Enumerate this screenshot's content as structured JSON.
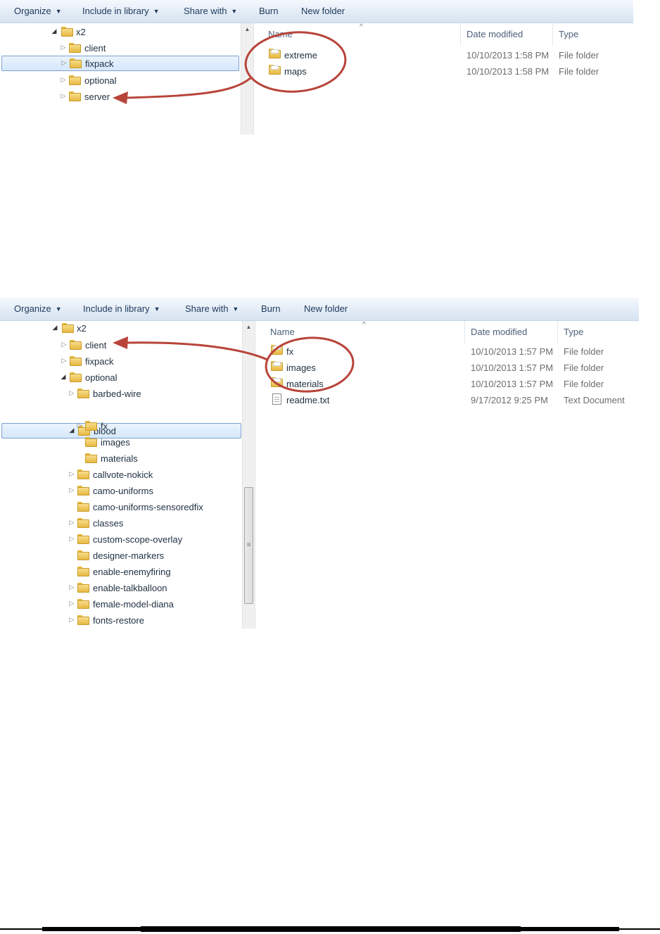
{
  "toolbar": {
    "organize": "Organize",
    "include_in_library": "Include in library",
    "share_with": "Share with",
    "burn": "Burn",
    "new_folder": "New folder"
  },
  "columns": {
    "name": "Name",
    "date_modified": "Date modified",
    "type": "Type"
  },
  "screen1": {
    "tree": [
      {
        "label": "x2"
      },
      {
        "label": "client"
      },
      {
        "label": "fixpack",
        "selected": true
      },
      {
        "label": "optional"
      },
      {
        "label": "server"
      }
    ],
    "files": [
      {
        "name": "extreme",
        "date": "10/10/2013 1:58 PM",
        "type": "File folder"
      },
      {
        "name": "maps",
        "date": "10/10/2013 1:58 PM",
        "type": "File folder"
      }
    ]
  },
  "screen2": {
    "tree": [
      {
        "label": "x2"
      },
      {
        "label": "client"
      },
      {
        "label": "fixpack"
      },
      {
        "label": "optional"
      },
      {
        "label": "barbed-wire"
      },
      {
        "label": "blood",
        "selected": true
      },
      {
        "label": "fx"
      },
      {
        "label": "images"
      },
      {
        "label": "materials"
      },
      {
        "label": "callvote-nokick"
      },
      {
        "label": "camo-uniforms"
      },
      {
        "label": "camo-uniforms-sensoredfix"
      },
      {
        "label": "classes"
      },
      {
        "label": "custom-scope-overlay"
      },
      {
        "label": "designer-markers"
      },
      {
        "label": "enable-enemyfiring"
      },
      {
        "label": "enable-talkballoon"
      },
      {
        "label": "female-model-diana"
      },
      {
        "label": "fonts-restore"
      }
    ],
    "files": [
      {
        "name": "fx",
        "date": "10/10/2013 1:57 PM",
        "type": "File folder"
      },
      {
        "name": "images",
        "date": "10/10/2013 1:57 PM",
        "type": "File folder"
      },
      {
        "name": "materials",
        "date": "10/10/2013 1:57 PM",
        "type": "File folder"
      },
      {
        "name": "readme.txt",
        "date": "9/17/2012 9:25 PM",
        "type": "Text Document"
      }
    ]
  },
  "colors": {
    "annotation_red": "#b8443a",
    "selection_border": "#7da2ce",
    "folder_yellow": "#e7b843"
  }
}
